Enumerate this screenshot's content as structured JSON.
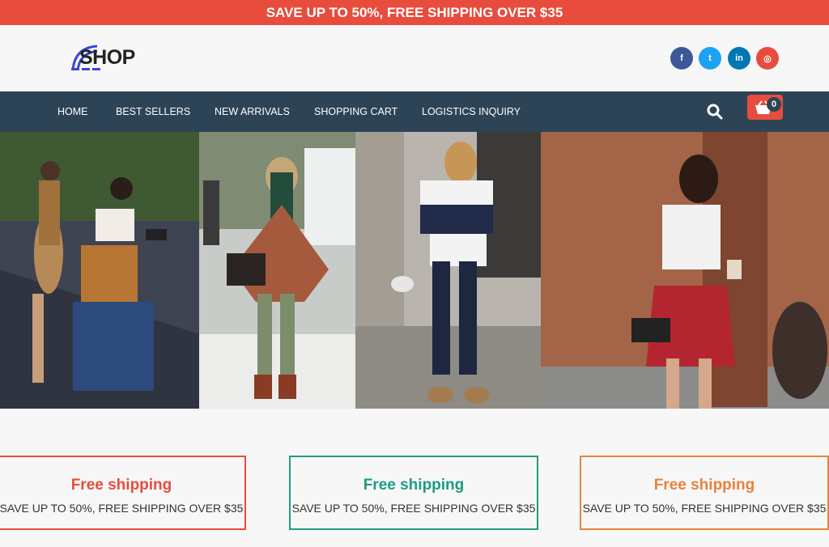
{
  "promo": {
    "text": "SAVE UP TO 50%, FREE SHIPPING OVER $35"
  },
  "header": {
    "logo_text": "SHOP",
    "social": [
      {
        "name": "facebook-icon",
        "glyph": "f",
        "color": "#3b5998"
      },
      {
        "name": "twitter-icon",
        "glyph": "t",
        "color": "#1da1f2"
      },
      {
        "name": "linkedin-icon",
        "glyph": "in",
        "color": "#0077b5"
      },
      {
        "name": "instagram-icon",
        "glyph": "◎",
        "color": "#e84c3d"
      }
    ]
  },
  "nav": {
    "items": [
      {
        "label": "HOME"
      },
      {
        "label": "BEST SELLERS"
      },
      {
        "label": "NEW ARRIVALS"
      },
      {
        "label": "SHOPPING CART"
      },
      {
        "label": "LOGISTICS INQUIRY"
      }
    ],
    "cart_count": "0"
  },
  "features": [
    {
      "title": "Free shipping",
      "desc": "SAVE UP TO 50%, FREE SHIPPING OVER $35",
      "color": "#e84c3d"
    },
    {
      "title": "Free shipping",
      "desc": "SAVE UP TO 50%, FREE SHIPPING OVER $35",
      "color": "#1f9b82"
    },
    {
      "title": "Free shipping",
      "desc": "SAVE UP TO 50%, FREE SHIPPING OVER $35",
      "color": "#e8823d"
    }
  ],
  "colors": {
    "accent": "#e84c3d",
    "nav_bg": "#2d4457"
  }
}
